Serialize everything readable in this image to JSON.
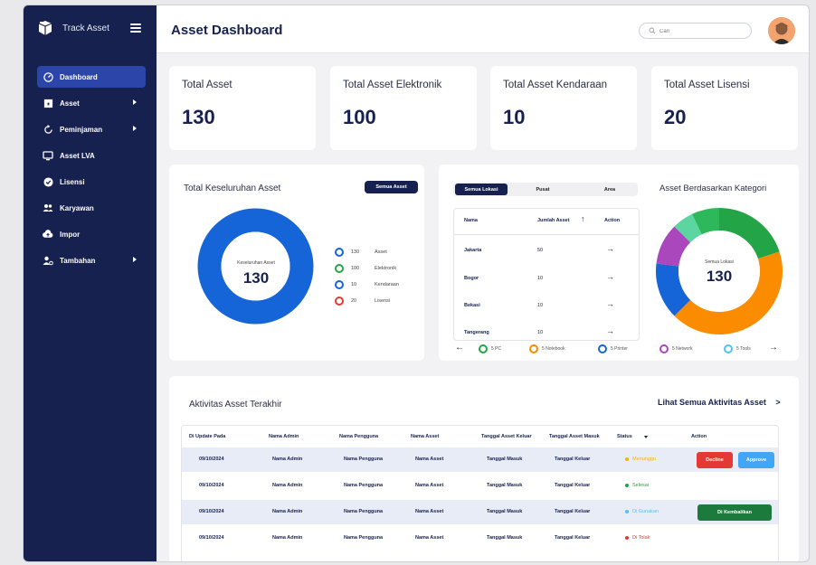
{
  "brand": {
    "name": "Track Asset"
  },
  "sidebar": {
    "items": [
      {
        "label": "Dashboard",
        "active": true
      },
      {
        "label": "Asset",
        "arrow": true
      },
      {
        "label": "Peminjaman",
        "arrow": true
      },
      {
        "label": "Asset LVA"
      },
      {
        "label": "Lisensi"
      },
      {
        "label": "Karyawan"
      },
      {
        "label": "Impor"
      },
      {
        "label": "Tambahan",
        "arrow": true
      }
    ]
  },
  "header": {
    "title": "Asset Dashboard",
    "search_placeholder": "Cari"
  },
  "stats": [
    {
      "label": "Total Asset",
      "value": "130"
    },
    {
      "label": "Total Asset Elektronik",
      "value": "100"
    },
    {
      "label": "Total Asset Kendaraan",
      "value": "10"
    },
    {
      "label": "Total Asset Lisensi",
      "value": "20"
    }
  ],
  "keseluruhan": {
    "title": "Total Keseluruhan Asset",
    "button": "Semua Asset",
    "center_label": "Keseluruhan Asset",
    "center_value": "130",
    "legend": [
      {
        "value": "130",
        "label": "Asset",
        "color": "#1565d8"
      },
      {
        "value": "100",
        "label": "Elektronik",
        "color": "#22a447"
      },
      {
        "value": "10",
        "label": "Kendaraan",
        "color": "#1565d8"
      },
      {
        "value": "20",
        "label": "Lisensi",
        "color": "#e53935"
      }
    ]
  },
  "lokasi": {
    "tabs": [
      "Semua Lokasi",
      "Pusat",
      "Area"
    ],
    "headers": {
      "nama": "Nama",
      "jumlah": "Jumlah Asset",
      "action": "Action"
    },
    "rows": [
      {
        "nama": "Jakarta",
        "jumlah": "50"
      },
      {
        "nama": "Bogor",
        "jumlah": "10"
      },
      {
        "nama": "Bekasi",
        "jumlah": "10"
      },
      {
        "nama": "Tangerang",
        "jumlah": "10"
      }
    ]
  },
  "kategori": {
    "title": "Asset Berdasarkan Kategori",
    "center_label": "Semua Lokasi",
    "center_value": "130",
    "legend": [
      {
        "label": "5 PC",
        "color": "#22a447"
      },
      {
        "label": "5 Notebook",
        "color": "#fb8c00"
      },
      {
        "label": "5 Printer",
        "color": "#1565d8"
      },
      {
        "label": "5 Network",
        "color": "#ab47bc"
      },
      {
        "label": "5 Tools",
        "color": "#4fc3f7"
      }
    ]
  },
  "aktivitas": {
    "title": "Aktivitas Asset Terakhir",
    "link": "Lihat Semua Aktivitas Asset",
    "headers": [
      "Di Update Pada",
      "Nama Admin",
      "Nama Pengguna",
      "Nama Asset",
      "Tanggal Asset Keluar",
      "Tanggal Asset Masuk",
      "Status",
      "Action"
    ],
    "rows": [
      {
        "date": "09/10/2024",
        "admin": "Nama Admin",
        "pengguna": "Nama Pengguna",
        "asset": "Nama Asset",
        "keluar": "Tanggal Masuk",
        "masuk": "Tanggal Keluar",
        "status": "Menunggu",
        "status_color": "#f4b400",
        "highlight": true
      },
      {
        "date": "09/10/2024",
        "admin": "Nama Admin",
        "pengguna": "Nama Pengguna",
        "asset": "Nama Asset",
        "keluar": "Tanggal Masuk",
        "masuk": "Tanggal Keluar",
        "status": "Selesai",
        "status_color": "#22a447",
        "highlight": false
      },
      {
        "date": "09/10/2024",
        "admin": "Nama Admin",
        "pengguna": "Nama Pengguna",
        "asset": "Nama Asset",
        "keluar": "Tanggal Masuk",
        "masuk": "Tanggal Keluar",
        "status": "Di Gunakan",
        "status_color": "#4fc3f7",
        "highlight": true
      },
      {
        "date": "09/10/2024",
        "admin": "Nama Admin",
        "pengguna": "Nama Pengguna",
        "asset": "Nama Asset",
        "keluar": "Tanggal Masuk",
        "masuk": "Tanggal Keluar",
        "status": "Di Tolak",
        "status_color": "#e53935",
        "highlight": false
      }
    ],
    "buttons": {
      "decline": "Decline",
      "approve": "Approve",
      "kembalikan": "Di Kembalikan"
    }
  },
  "colors": {
    "navy": "#16214f",
    "active": "#2b46a8",
    "blue": "#1565d8",
    "decline": "#e53935",
    "approve": "#42a5f5",
    "kembalikan": "#1b7a3c"
  }
}
